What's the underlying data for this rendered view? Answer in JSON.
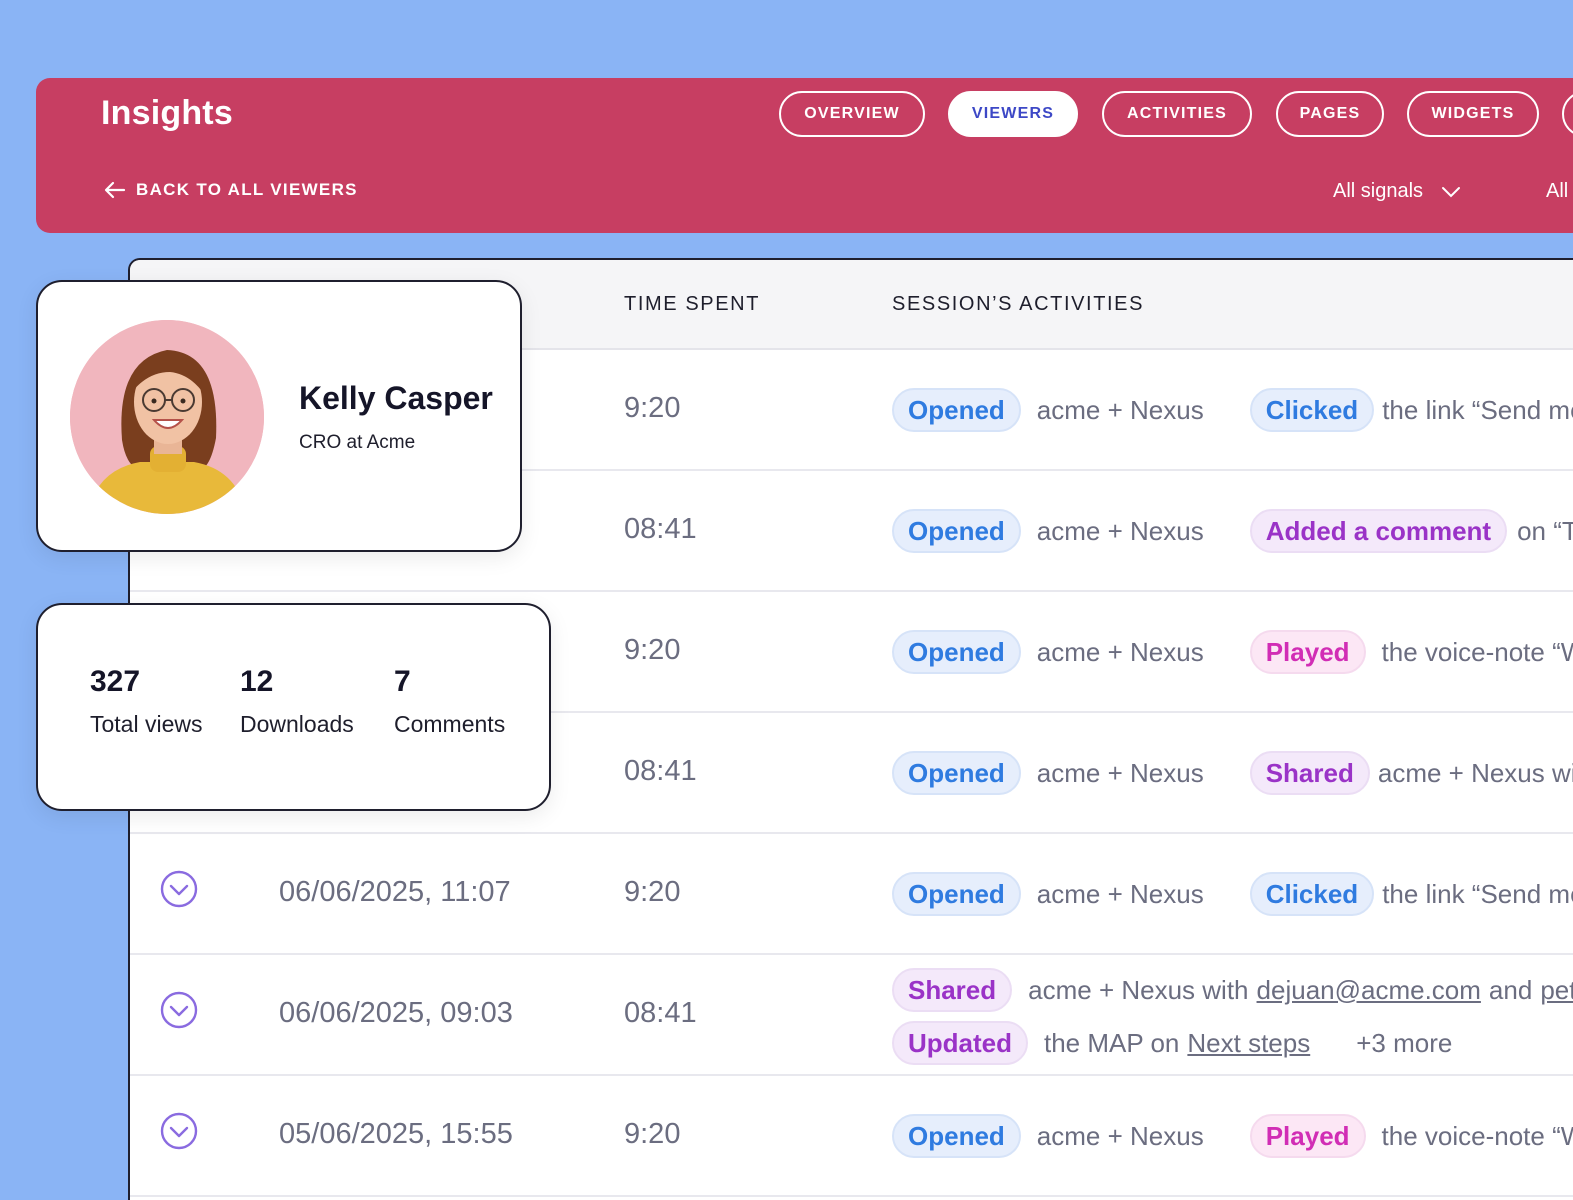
{
  "header": {
    "title": "Insights",
    "tabs": [
      "OVERVIEW",
      "VIEWERS",
      "ACTIVITIES",
      "PAGES",
      "WIDGETS"
    ],
    "active_tab": "VIEWERS",
    "back_label": "BACK TO ALL VIEWERS",
    "signals_filter": "All signals",
    "second_filter_partial": "All"
  },
  "profile": {
    "name": "Kelly Casper",
    "role": "CRO at Acme"
  },
  "stats": [
    {
      "value": "327",
      "label": "Total views"
    },
    {
      "value": "12",
      "label": "Downloads"
    },
    {
      "value": "7",
      "label": "Comments"
    }
  ],
  "table": {
    "headers": {
      "time": "TIME SPENT",
      "activities": "SESSION’S ACTIVITIES"
    },
    "rows": [
      {
        "date": "",
        "time": "9:20",
        "a1": "Opened",
        "t1": "acme + Nexus",
        "a2": "Clicked",
        "t2": "the link “Send me"
      },
      {
        "date": "",
        "time": "08:41",
        "a1": "Opened",
        "t1": "acme + Nexus",
        "a2": "Added a comment",
        "t2": "on “Te"
      },
      {
        "date": "",
        "time": "9:20",
        "a1": "Opened",
        "t1": "acme + Nexus",
        "a2": "Played",
        "t2": "the voice-note “W"
      },
      {
        "date": "",
        "time": "08:41",
        "a1": "Opened",
        "t1": "acme + Nexus",
        "a2": "Shared",
        "t2": "acme + Nexus wit"
      },
      {
        "date": "06/06/2025, 11:07",
        "time": "9:20",
        "a1": "Opened",
        "t1": "acme + Nexus",
        "a2": "Clicked",
        "t2": "the link “Send me"
      },
      {
        "date": "06/06/2025, 09:03",
        "time": "08:41",
        "line1": {
          "a": "Shared",
          "t": "acme + Nexus with",
          "link1": "dejuan@acme.com",
          "mid": "and",
          "link2": "pete"
        },
        "line2": {
          "a": "Updated",
          "t": "the MAP on",
          "link": "Next steps",
          "more": "+3 more"
        }
      },
      {
        "date": "05/06/2025, 15:55",
        "time": "9:20",
        "a1": "Opened",
        "t1": "acme + Nexus",
        "a2": "Played",
        "t2": "the voice-note “W"
      }
    ]
  },
  "colors": {
    "background": "#8AB4F5",
    "header": "#C73E62",
    "active_tab_text": "#3D48C6",
    "opened_pill": "#2F7BE0",
    "purple_pill": "#9A33C7",
    "pink_pill": "#D12DB5"
  }
}
